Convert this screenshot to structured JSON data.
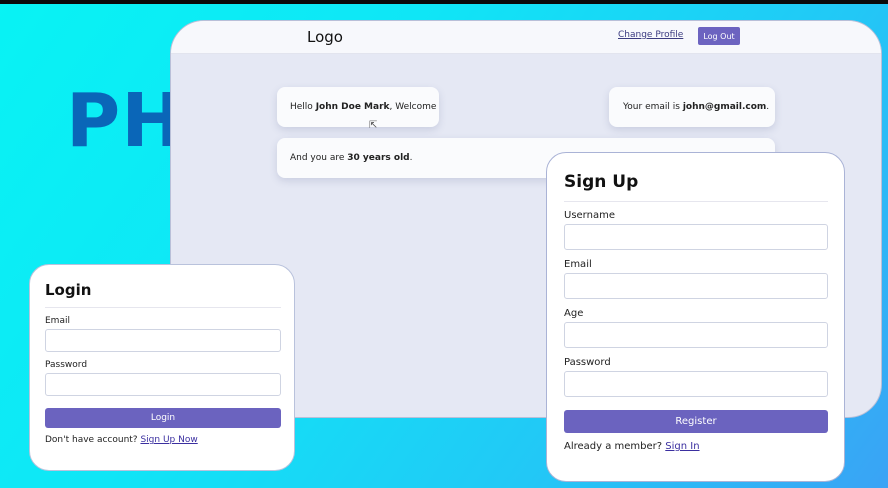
{
  "banner": {
    "title": "PHP"
  },
  "app": {
    "logo": "Logo",
    "change_profile": "Change Profile",
    "logout": "Log Out",
    "hello": {
      "prefix": "Hello ",
      "name": "John Doe Mark",
      "suffix": ", Welcome"
    },
    "email": {
      "prefix": "Your email is ",
      "value": "john@gmail.com",
      "suffix": "."
    },
    "age": {
      "prefix": "And you are ",
      "value": "30 years old",
      "suffix": "."
    }
  },
  "login": {
    "title": "Login",
    "email_label": "Email",
    "password_label": "Password",
    "submit": "Login",
    "footer_text": "Don't have account? ",
    "footer_link": "Sign Up Now"
  },
  "signup": {
    "title": "Sign Up",
    "username_label": "Username",
    "email_label": "Email",
    "age_label": "Age",
    "password_label": "Password",
    "submit": "Register",
    "footer_text": "Already a member? ",
    "footer_link": "Sign In"
  },
  "colors": {
    "accent": "#6b63bf",
    "php_blue": "#0a66b8",
    "background": "#08f3f4"
  }
}
